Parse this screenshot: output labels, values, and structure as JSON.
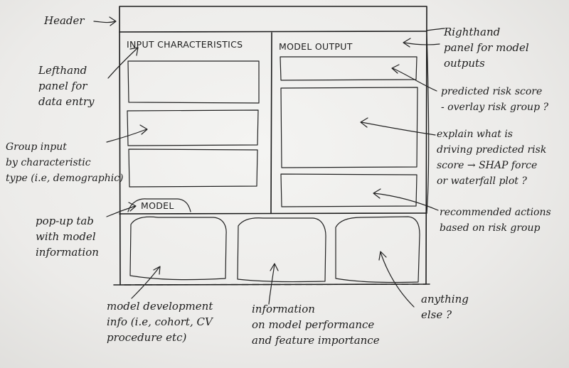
{
  "panels": {
    "input_title": "INPUT CHARACTERISTICS",
    "output_title": "MODEL OUTPUT",
    "model_tab": "MODEL"
  },
  "annotations": {
    "header": "Header",
    "left_panel": "Lefthand\npanel for\ndata entry",
    "group_input": "Group input\nby characteristic\ntype (i.e, demographic)",
    "popup_tab": "pop-up tab\nwith model\ninformation",
    "right_panel": "Righthand\npanel for model\noutputs",
    "risk_score": "predicted risk score\n- overlay risk group ?",
    "explain": "explain what is\ndriving predicted risk\nscore → SHAP force\nor waterfall plot ?",
    "actions": "recommended actions\nbased on risk group",
    "model_dev": "model development\ninfo (i.e, cohort, CV\nprocedure etc)",
    "performance": "information\non model performance\nand feature importance",
    "anything": "anything\nelse ?"
  }
}
